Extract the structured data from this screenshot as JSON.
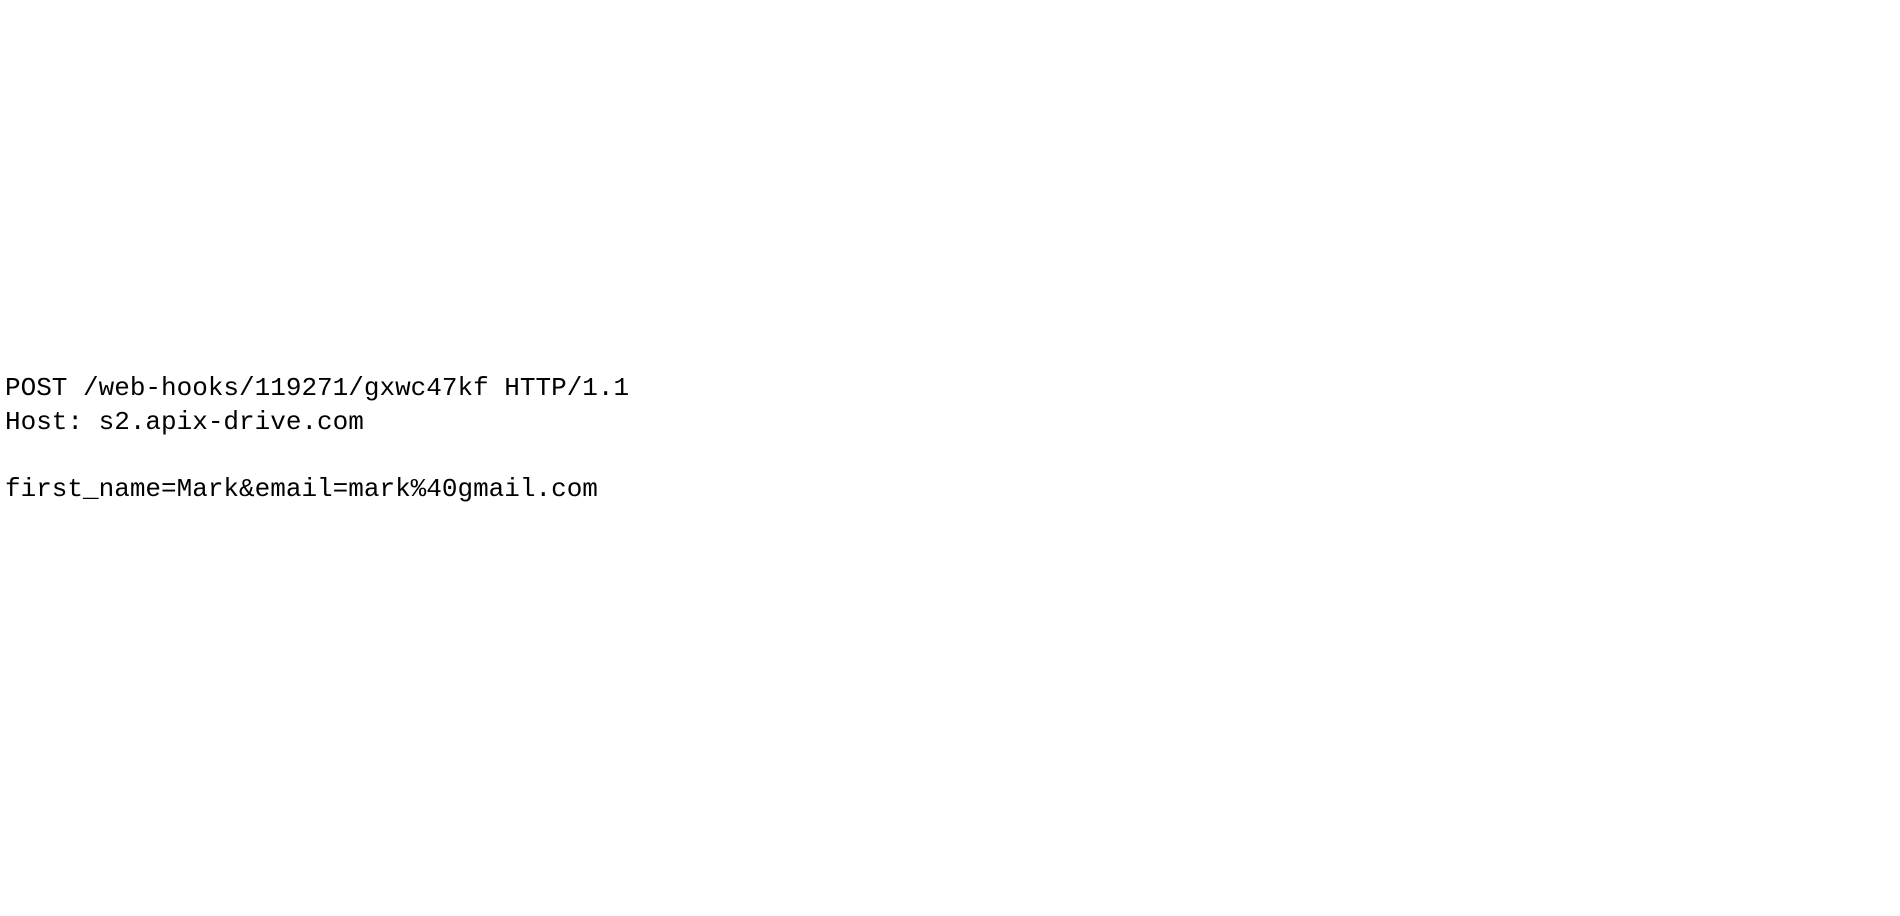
{
  "http_request": {
    "request_line": "POST /web-hooks/119271/gxwc47kf HTTP/1.1",
    "host_header": "Host: s2.apix-drive.com",
    "blank_line": "",
    "body": "first_name=Mark&email=mark%40gmail.com"
  }
}
